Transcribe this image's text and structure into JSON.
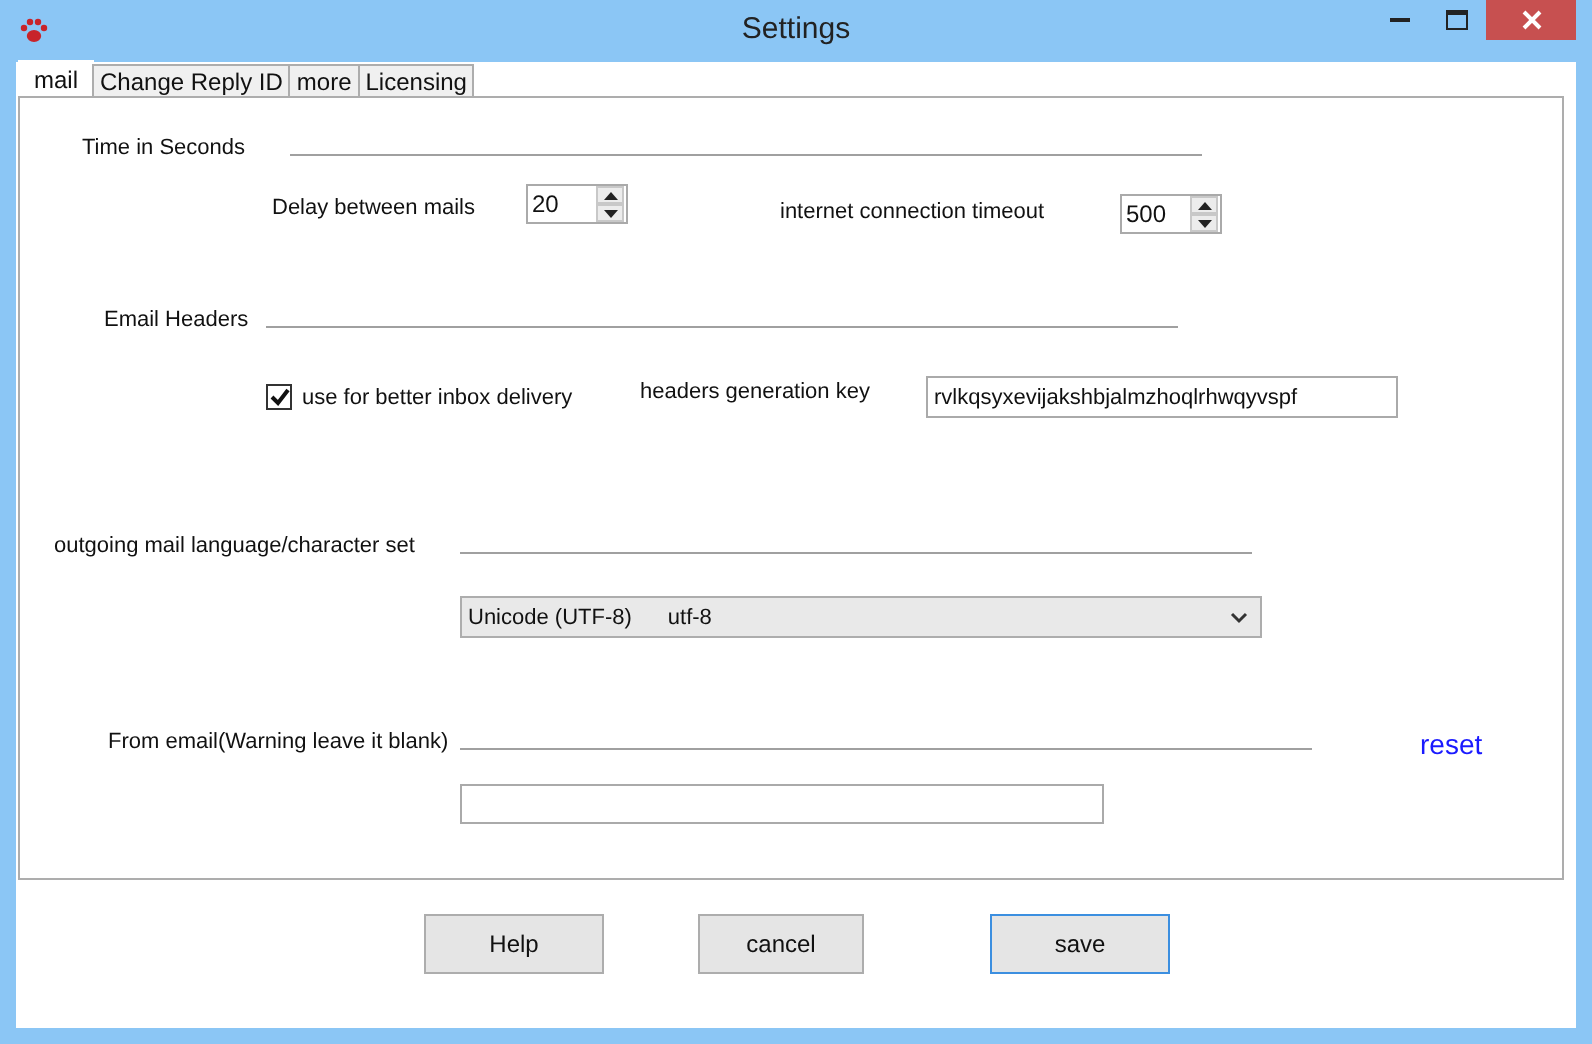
{
  "window": {
    "title": "Settings"
  },
  "tabs": [
    {
      "label": "mail",
      "selected": true
    },
    {
      "label": "Change Reply ID",
      "selected": false
    },
    {
      "label": "more",
      "selected": false
    },
    {
      "label": "Licensing",
      "selected": false
    }
  ],
  "time_section": {
    "title": "Time in Seconds",
    "delay_label": "Delay between mails",
    "delay_value": "20",
    "timeout_label": "internet connection timeout",
    "timeout_value": "500"
  },
  "headers_section": {
    "title": "Email Headers",
    "checkbox": {
      "label": "use for better inbox delivery",
      "checked": true
    },
    "key_label": "headers generation key",
    "key_value": "rvlkqsyxevijakshbjalmzhoqlrhwqyvspf"
  },
  "charset_section": {
    "title": "outgoing mail language/character set",
    "selected_name": "Unicode (UTF-8)",
    "selected_code": "utf-8"
  },
  "from_section": {
    "title": "From email(Warning leave it blank)",
    "reset_link": "reset"
  },
  "buttons": [
    {
      "label": "Help",
      "default": false
    },
    {
      "label": "cancel",
      "default": false
    },
    {
      "label": "save",
      "default": true
    }
  ]
}
